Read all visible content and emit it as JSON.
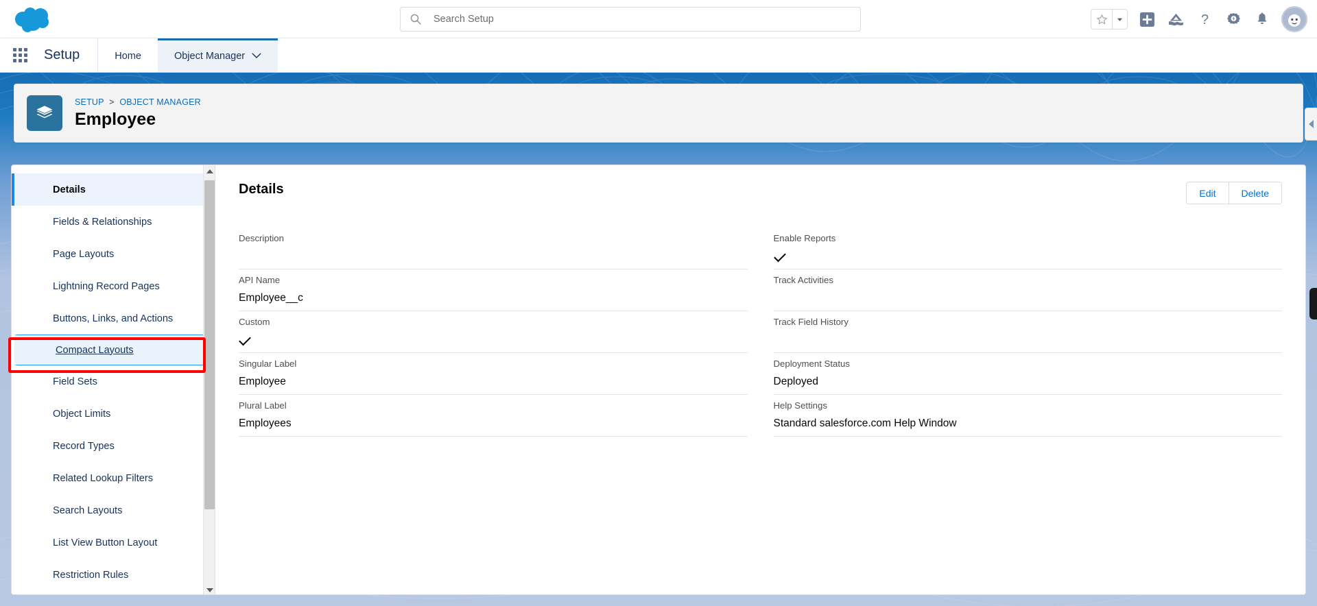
{
  "header": {
    "logo_icon": "salesforce-cloud-logo",
    "search": {
      "placeholder": "Search Setup",
      "value": "",
      "icon": "search-icon"
    },
    "icons": [
      {
        "name": "favorites-star-icon",
        "glyph": "star"
      },
      {
        "name": "favorites-dropdown-icon",
        "glyph": "caret-down"
      },
      {
        "name": "global-actions-plus-icon",
        "glyph": "plus"
      },
      {
        "name": "setup-assistant-icon",
        "glyph": "mountain"
      },
      {
        "name": "help-icon",
        "glyph": "question-mark"
      },
      {
        "name": "setup-gear-icon",
        "glyph": "gear"
      },
      {
        "name": "notifications-bell-icon",
        "glyph": "bell"
      },
      {
        "name": "user-avatar",
        "glyph": "astro-avatar"
      }
    ]
  },
  "setup_bar": {
    "app_launcher_icon": "app-launcher-waffle-icon",
    "title": "Setup",
    "tabs": [
      {
        "label": "Home",
        "active": false,
        "has_menu": false
      },
      {
        "label": "Object Manager",
        "active": true,
        "has_menu": true
      }
    ]
  },
  "record_header": {
    "object_icon": "custom-object-layers-icon",
    "breadcrumb": {
      "items": [
        "SETUP",
        "OBJECT MANAGER"
      ],
      "separator": ">"
    },
    "title": "Employee",
    "collapse_tab_icon": "collapse-left-triangle-icon"
  },
  "sidebar": {
    "items": [
      {
        "label": "Details",
        "state": "active"
      },
      {
        "label": "Fields & Relationships",
        "state": "normal"
      },
      {
        "label": "Page Layouts",
        "state": "normal"
      },
      {
        "label": "Lightning Record Pages",
        "state": "normal"
      },
      {
        "label": "Buttons, Links, and Actions",
        "state": "normal"
      },
      {
        "label": "Compact Layouts",
        "state": "focused"
      },
      {
        "label": "Field Sets",
        "state": "normal"
      },
      {
        "label": "Object Limits",
        "state": "normal"
      },
      {
        "label": "Record Types",
        "state": "normal"
      },
      {
        "label": "Related Lookup Filters",
        "state": "normal"
      },
      {
        "label": "Search Layouts",
        "state": "normal"
      },
      {
        "label": "List View Button Layout",
        "state": "normal"
      },
      {
        "label": "Restriction Rules",
        "state": "normal"
      }
    ],
    "scrollbar": {
      "up_arrow_icon": "scroll-up-arrow-icon",
      "down_arrow_icon": "scroll-down-arrow-icon"
    },
    "highlight": {
      "target": "Compact Layouts",
      "color": "#ff0000"
    }
  },
  "detail": {
    "title": "Details",
    "actions": [
      {
        "label": "Edit",
        "name": "edit-button"
      },
      {
        "label": "Delete",
        "name": "delete-button"
      }
    ],
    "left_fields": [
      {
        "label": "Description",
        "value": "",
        "type": "text"
      },
      {
        "label": "API Name",
        "value": "Employee__c",
        "type": "text"
      },
      {
        "label": "Custom",
        "value": "",
        "type": "checkmark"
      },
      {
        "label": "Singular Label",
        "value": "Employee",
        "type": "text"
      },
      {
        "label": "Plural Label",
        "value": "Employees",
        "type": "text"
      }
    ],
    "right_fields": [
      {
        "label": "Enable Reports",
        "value": "",
        "type": "checkmark"
      },
      {
        "label": "Track Activities",
        "value": "",
        "type": "text"
      },
      {
        "label": "Track Field History",
        "value": "",
        "type": "text"
      },
      {
        "label": "Deployment Status",
        "value": "Deployed",
        "type": "text"
      },
      {
        "label": "Help Settings",
        "value": "Standard salesforce.com Help Window",
        "type": "text"
      }
    ]
  },
  "colors": {
    "brand_blue": "#1b96ff",
    "link_blue": "#0070d2",
    "breadcrumb_blue": "#0f6bb5",
    "object_icon_bg": "#2a739e",
    "active_tab_bg": "#ecf2f8",
    "highlight_red": "#ff0000",
    "page_bg_blue": "#176db5"
  }
}
